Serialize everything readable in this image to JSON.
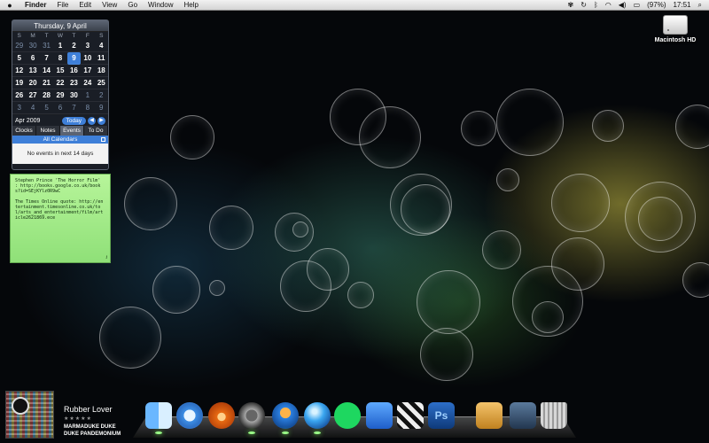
{
  "menubar": {
    "apple_icon": "apple-logo-icon",
    "app_name": "Finder",
    "menus": [
      "File",
      "Edit",
      "View",
      "Go",
      "Window",
      "Help"
    ],
    "battery_text": "(97%)",
    "clock": "17:51"
  },
  "calendar": {
    "title": "Thursday, 9 April",
    "weekdays": [
      "S",
      "M",
      "T",
      "W",
      "T",
      "F",
      "S"
    ],
    "weeks": [
      [
        "29",
        "30",
        "31",
        "1",
        "2",
        "3",
        "4"
      ],
      [
        "5",
        "6",
        "7",
        "8",
        "9",
        "10",
        "11"
      ],
      [
        "12",
        "13",
        "14",
        "15",
        "16",
        "17",
        "18"
      ],
      [
        "19",
        "20",
        "21",
        "22",
        "23",
        "24",
        "25"
      ],
      [
        "26",
        "27",
        "28",
        "29",
        "30",
        "1",
        "2"
      ],
      [
        "3",
        "4",
        "5",
        "6",
        "7",
        "8",
        "9"
      ]
    ],
    "dim_cells": [
      [
        0,
        0
      ],
      [
        0,
        1
      ],
      [
        0,
        2
      ],
      [
        4,
        5
      ],
      [
        4,
        6
      ],
      [
        5,
        0
      ],
      [
        5,
        1
      ],
      [
        5,
        2
      ],
      [
        5,
        3
      ],
      [
        5,
        4
      ],
      [
        5,
        5
      ],
      [
        5,
        6
      ]
    ],
    "today_cell": [
      1,
      4
    ],
    "month_label": "Apr 2009",
    "today_button": "Today",
    "tabs": [
      "Clocks",
      "Notes",
      "Events",
      "To Do"
    ],
    "active_tab": "Events",
    "section_label": "All Calendars",
    "events_message": "No events in next 14 days"
  },
  "sticky_note": {
    "lines": [
      "Stephen Prince 'The Horror Film' : http://books.google.co.uk/books?id=SEjKYlz0R9wC",
      "The Times Online quote: http://entertainment.timesonline.co.uk/tol/arts_and_entertainment/film/article2621869.ece"
    ],
    "info_mark": "i"
  },
  "desktop_icon": {
    "label": "Macintosh HD"
  },
  "now_playing": {
    "title": "Rubber Lover",
    "stars": "★★★★★",
    "artist": "MARMADUKE DUKE",
    "album": "DUKE PANDEMONIUM"
  },
  "dock": {
    "items": [
      {
        "name": "finder",
        "glyph": "",
        "running": true
      },
      {
        "name": "safari",
        "glyph": "",
        "running": false
      },
      {
        "name": "firefox",
        "glyph": "",
        "running": false
      },
      {
        "name": "audio",
        "glyph": "",
        "running": true
      },
      {
        "name": "bird",
        "glyph": "",
        "running": true
      },
      {
        "name": "globe",
        "glyph": "",
        "running": true
      },
      {
        "name": "spotify",
        "glyph": "",
        "running": false
      },
      {
        "name": "flag",
        "glyph": "",
        "running": false
      },
      {
        "name": "clapper",
        "glyph": "",
        "running": false
      },
      {
        "name": "photoshop",
        "glyph": "Ps",
        "running": false
      },
      {
        "name": "pencil",
        "glyph": "",
        "running": false
      },
      {
        "name": "stack",
        "glyph": "",
        "running": false
      },
      {
        "name": "trash",
        "glyph": "",
        "running": false
      }
    ]
  },
  "colors": {
    "accent": "#3e7fd8",
    "sticky": "#a6ec8c"
  }
}
